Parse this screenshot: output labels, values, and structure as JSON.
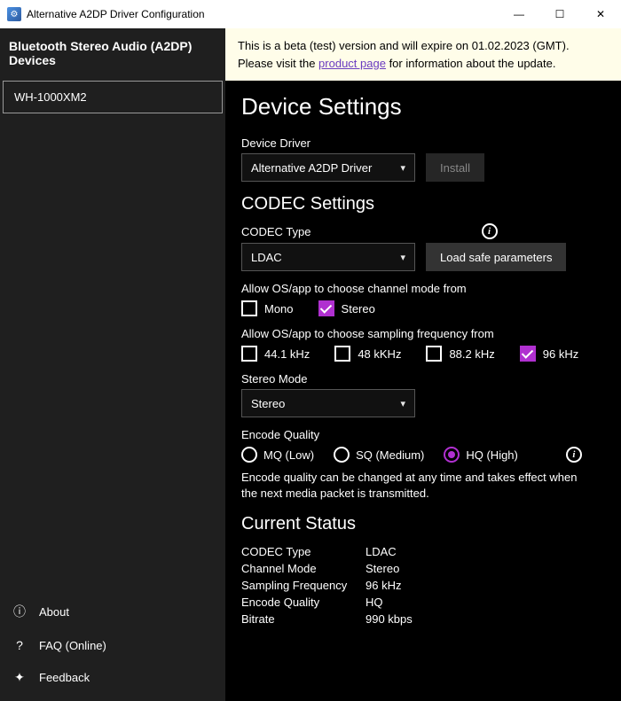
{
  "window": {
    "title": "Alternative A2DP Driver Configuration"
  },
  "banner": {
    "line1_a": "This is a beta (test) version and will expire on 01.02.2023 (GMT).",
    "line2_a": "Please visit the ",
    "link": "product page",
    "line2_b": " for information about the update."
  },
  "sidebar": {
    "header": "Bluetooth Stereo Audio (A2DP) Devices",
    "device": "WH-1000XM2",
    "about": "About",
    "faq": "FAQ (Online)",
    "feedback": "Feedback"
  },
  "headings": {
    "device_settings": "Device Settings",
    "codec_settings": "CODEC Settings",
    "current_status": "Current Status"
  },
  "driver": {
    "label": "Device Driver",
    "selected": "Alternative A2DP Driver",
    "install": "Install"
  },
  "codec": {
    "type_label": "CODEC Type",
    "selected": "LDAC",
    "load_safe": "Load safe parameters"
  },
  "channel": {
    "label": "Allow OS/app to choose channel mode from",
    "mono": "Mono",
    "stereo": "Stereo"
  },
  "sampling": {
    "label": "Allow OS/app to choose sampling frequency from",
    "f44": "44.1 kHz",
    "f48": "48 kKHz",
    "f88": "88.2 kHz",
    "f96": "96 kHz"
  },
  "stereo_mode": {
    "label": "Stereo Mode",
    "selected": "Stereo"
  },
  "encode": {
    "label": "Encode Quality",
    "mq": "MQ (Low)",
    "sq": "SQ (Medium)",
    "hq": "HQ (High)",
    "help": "Encode quality can be changed at any time and takes effect when the next media packet is transmitted."
  },
  "status": {
    "codec_type_k": "CODEC Type",
    "codec_type_v": "LDAC",
    "channel_k": "Channel Mode",
    "channel_v": "Stereo",
    "sampling_k": "Sampling Frequency",
    "sampling_v": "96 kHz",
    "encode_k": "Encode Quality",
    "encode_v": "HQ",
    "bitrate_k": "Bitrate",
    "bitrate_v": "990 kbps"
  }
}
